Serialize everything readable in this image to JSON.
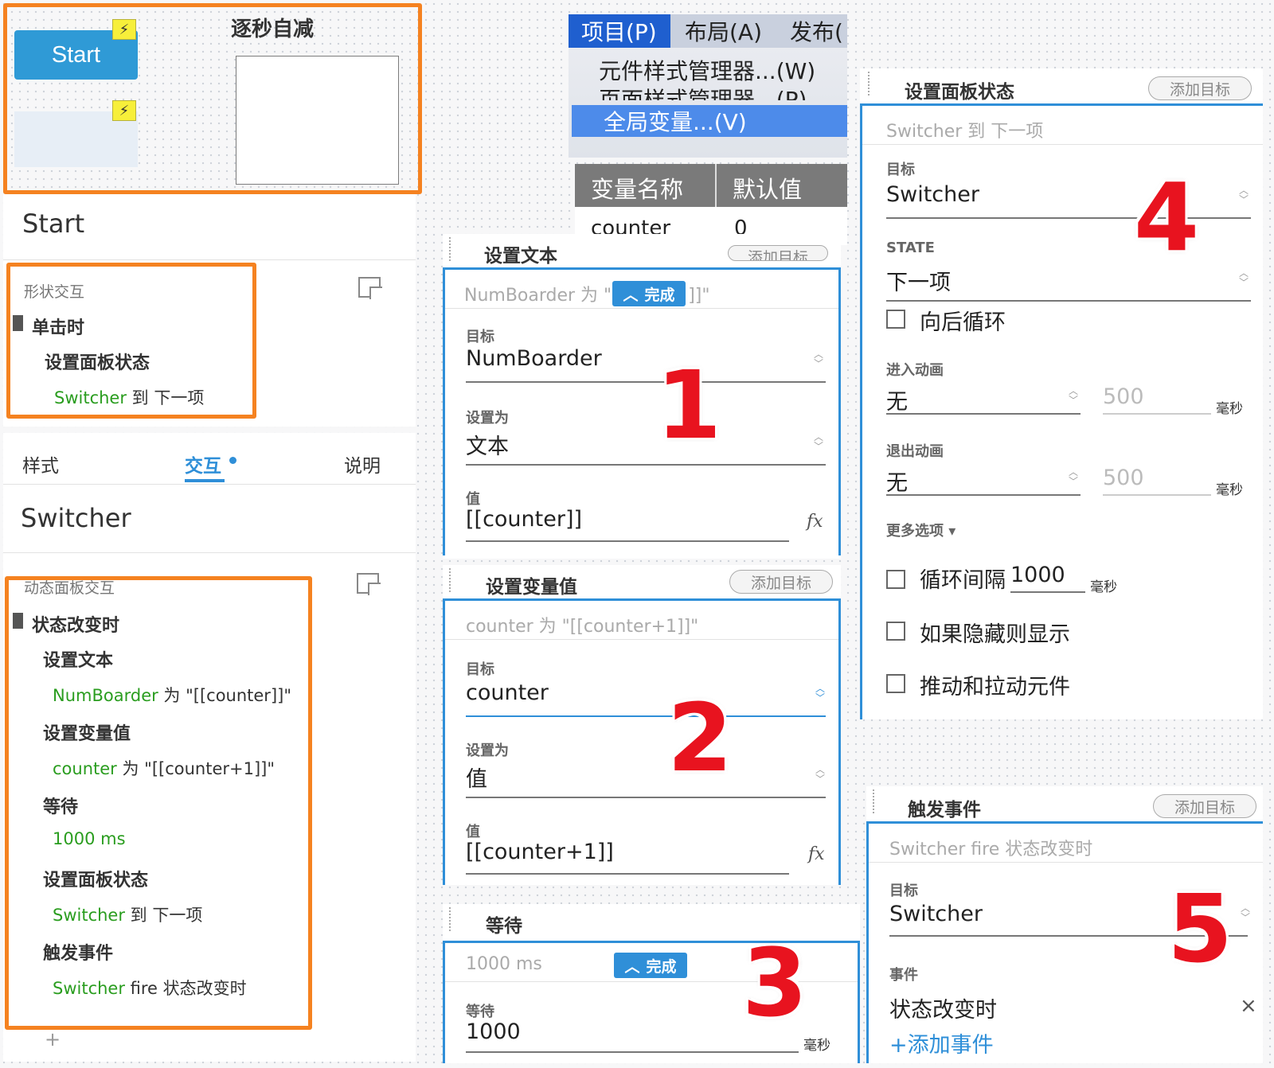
{
  "canvas": {
    "start_button": "Start",
    "countdown_title": "逐秒自减",
    "bolt_glyph": "⚡"
  },
  "start_inspector": {
    "title": "Start",
    "section": "形状交互",
    "event": "单击时",
    "action": "设置面板状态",
    "detail_target": "Switcher",
    "detail_rest": " 到 下一项"
  },
  "tabs": {
    "style": "样式",
    "interaction": "交互",
    "notes": "说明"
  },
  "switcher_inspector": {
    "title": "Switcher",
    "section": "动态面板交互",
    "event": "状态改变时",
    "actions": [
      {
        "name": "设置文本",
        "green": "NumBoarder",
        "rest": " 为 \"[[counter]]\""
      },
      {
        "name": "设置变量值",
        "green": "counter",
        "rest": " 为 \"[[counter+1]]\""
      },
      {
        "name": "等待",
        "green": "1000 ms",
        "rest": ""
      },
      {
        "name": "设置面板状态",
        "green": "Switcher",
        "rest": " 到 下一项"
      },
      {
        "name": "触发事件",
        "green": "Switcher",
        "rest": " fire 状态改变时"
      }
    ],
    "plus": "+"
  },
  "menu": {
    "items": [
      "项目(P)",
      "布局(A)",
      "发布("
    ],
    "dropdown": [
      "元件样式管理器...(W)",
      "页面样式管理器...(P)",
      "全局变量...(V)"
    ],
    "table_headers": [
      "变量名称",
      "默认值"
    ],
    "table_rows": [
      [
        "counter",
        "0"
      ]
    ]
  },
  "panel1": {
    "title": "设置文本",
    "add_target": "添加目标",
    "summary_left": "NumBoarder 为 \"",
    "summary_right": "]]\"",
    "done": "完成",
    "target_label": "目标",
    "target_value": "NumBoarder",
    "set_label": "设置为",
    "set_value": "文本",
    "value_label": "值",
    "value": "[[counter]]",
    "fx": "fx"
  },
  "panel2": {
    "title": "设置变量值",
    "add_target": "添加目标",
    "summary": "counter 为 \"[[counter+1]]\"",
    "target_label": "目标",
    "target_value": "counter",
    "set_label": "设置为",
    "set_value": "值",
    "value_label": "值",
    "value": "[[counter+1]]",
    "fx": "fx"
  },
  "panel3": {
    "title": "等待",
    "summary": "1000 ms",
    "done": "完成",
    "wait_label": "等待",
    "wait_value": "1000",
    "unit": "毫秒"
  },
  "panel4": {
    "title": "设置面板状态",
    "add_target": "添加目标",
    "summary": "Switcher 到 下一项",
    "target_label": "目标",
    "target_value": "Switcher",
    "state_label": "STATE",
    "state_value": "下一项",
    "loop_back": "向后循环",
    "enter_anim_label": "进入动画",
    "enter_anim_value": "无",
    "enter_ms": "500",
    "exit_anim_label": "退出动画",
    "exit_anim_value": "无",
    "exit_ms": "500",
    "unit": "毫秒",
    "more_options": "更多选项 ▾",
    "interval_label": "循环间隔",
    "interval_value": "1000",
    "show_if_hidden": "如果隐藏则显示",
    "push_pull": "推动和拉动元件"
  },
  "panel5": {
    "title": "触发事件",
    "add_target": "添加目标",
    "summary": "Switcher fire 状态改变时",
    "target_label": "目标",
    "target_value": "Switcher",
    "event_label": "事件",
    "event_value": "状态改变时",
    "add_event": "+添加事件",
    "close": "×"
  },
  "step_numbers": [
    "1",
    "2",
    "3",
    "4",
    "5"
  ],
  "colors": {
    "highlight_orange": "#f58220",
    "accent_blue": "#2f8fd8",
    "green_text": "#2a9d1f",
    "annotation_red": "#e8131f",
    "start_button": "#2f9ad6"
  }
}
